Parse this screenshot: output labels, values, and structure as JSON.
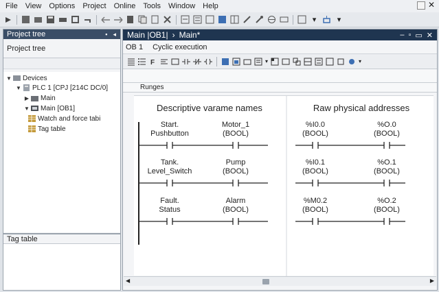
{
  "menu": [
    "File",
    "View",
    "Options",
    "Project",
    "Online",
    "Tools",
    "Window",
    "Help"
  ],
  "project_tree": {
    "title": "Project tree",
    "subtitle": "Project tree",
    "nodes": [
      {
        "label": "Devices",
        "level": 0,
        "arrow": "▼",
        "icon": "devices-icon"
      },
      {
        "label": "PLC 1 [CPJ [214C DC/0]",
        "level": 1,
        "arrow": "▼",
        "icon": "plc-icon"
      },
      {
        "label": "Main",
        "level": 2,
        "arrow": "▶",
        "icon": "folder-icon"
      },
      {
        "label": "Main [OB1]",
        "level": 2,
        "arrow": "▼",
        "icon": "block-icon"
      },
      {
        "label": "Watch and force tabi",
        "level": 3,
        "arrow": "",
        "icon": "table-icon"
      },
      {
        "label": "Tag table",
        "level": 3,
        "arrow": "",
        "icon": "table-icon"
      }
    ]
  },
  "tag_table": {
    "title": "Tag table"
  },
  "editor": {
    "path_block": "Main |OB1|",
    "path_sep": "›",
    "path_main": "Main*",
    "ob": "OB 1",
    "cyclic": "Cyclic execution",
    "rungs_label": "Runges"
  },
  "ladder": {
    "left_title": "Descriptive varame names",
    "right_title": "Raw physical addresses",
    "left_rungs": [
      {
        "in_line1": "Start.",
        "in_line2": "Pushbutton",
        "out_line1": "Motor_1",
        "out_line2": "(BOOL)"
      },
      {
        "in_line1": "Tank.",
        "in_line2": "Level_Switch",
        "out_line1": "Pump",
        "out_line2": "(BOOL)"
      },
      {
        "in_line1": "Fault.",
        "in_line2": "Status",
        "out_line1": "Alarm",
        "out_line2": "(BOOL)"
      }
    ],
    "right_rungs": [
      {
        "in_line1": "%I0.0",
        "in_line2": "(BOOL)",
        "out_line1": "%O.0",
        "out_line2": "(BOOL)"
      },
      {
        "in_line1": "%I0.1",
        "in_line2": "(BOOL)",
        "out_line1": "%O.1",
        "out_line2": "(BOOL)"
      },
      {
        "in_line1": "%M0.2",
        "in_line2": "(BOOL)",
        "out_line1": "%O.2",
        "out_line2": "(BOOL)"
      }
    ]
  },
  "colors": {
    "tree_header": "#3a4d66",
    "editor_header": "#1f3550",
    "rail": "#222222"
  }
}
